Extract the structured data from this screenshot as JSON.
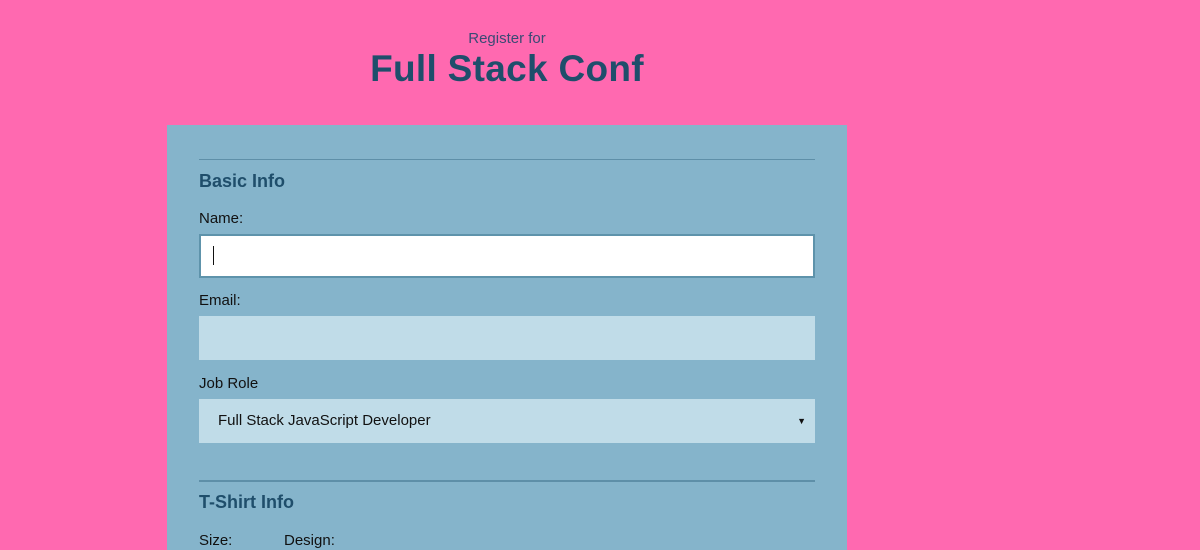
{
  "header": {
    "subtitle": "Register for",
    "title": "Full Stack Conf"
  },
  "basic_info": {
    "heading": "Basic Info",
    "name_label": "Name:",
    "name_value": "",
    "email_label": "Email:",
    "email_value": "",
    "job_role_label": "Job Role",
    "job_role_selected": "Full Stack JavaScript Developer",
    "dropdown_icon": "caret-down-icon"
  },
  "tshirt_info": {
    "heading": "T-Shirt Info",
    "size_label": "Size:",
    "design_label": "Design:"
  },
  "colors": {
    "background": "#ff69b0",
    "panel": "#85b4cb",
    "heading": "#1f4e6b",
    "input": "#c0dce8"
  }
}
